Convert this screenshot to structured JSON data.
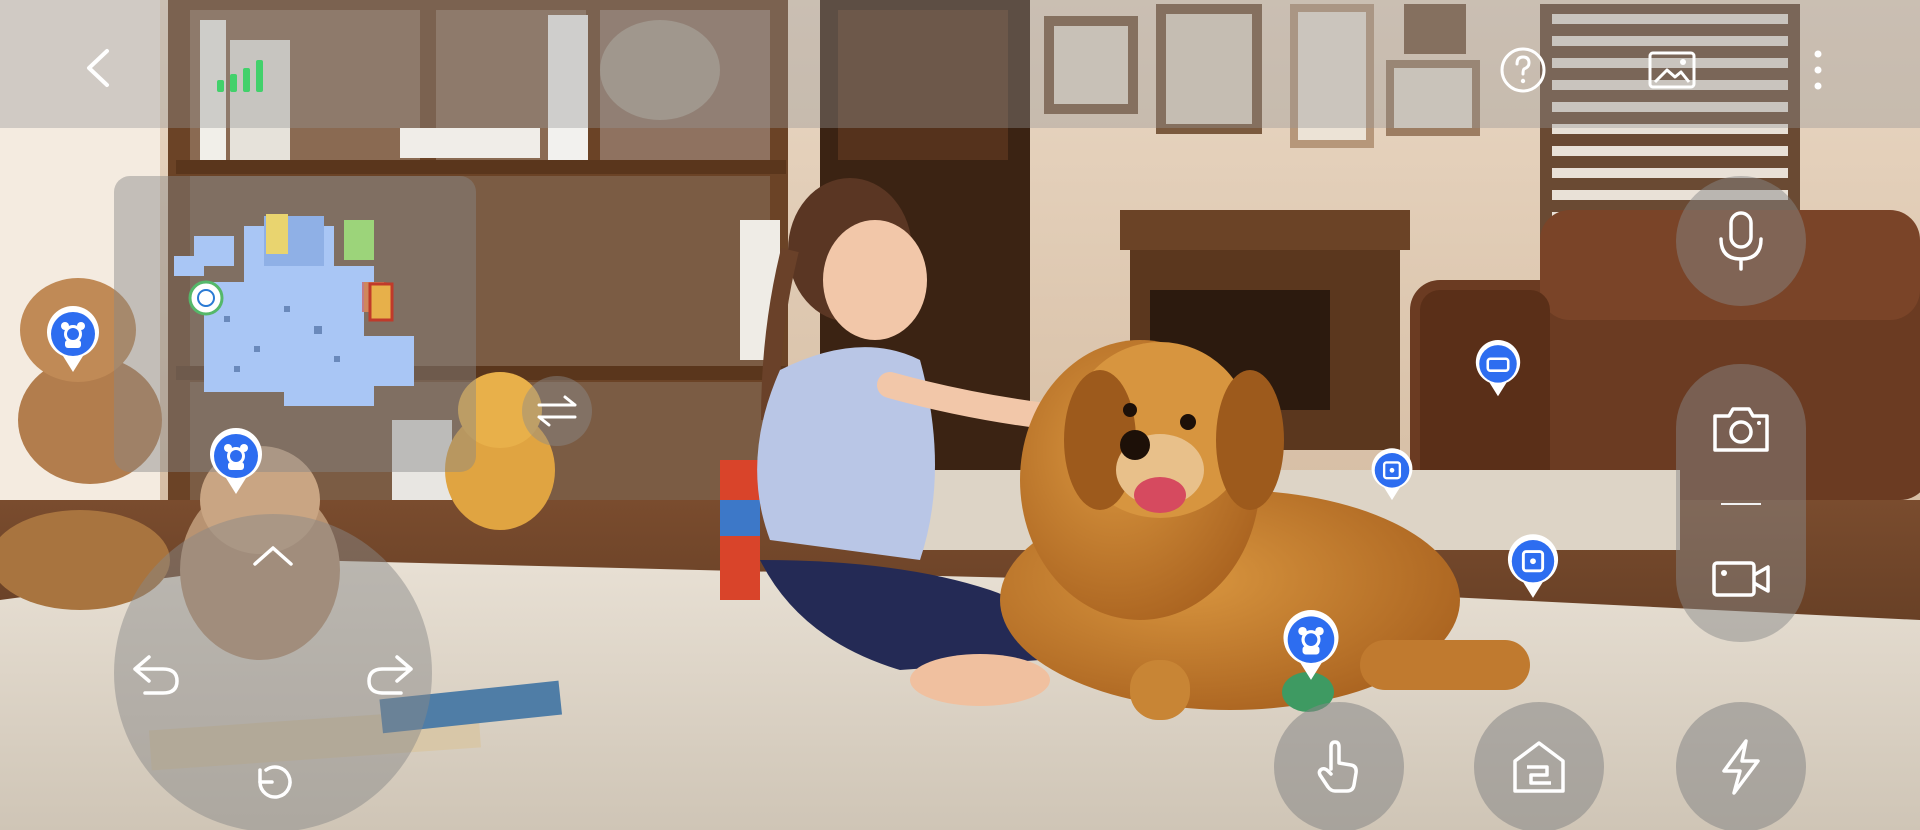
{
  "app": {
    "title": ""
  },
  "topbar": {
    "back_icon": "chevron-left-icon",
    "signal_icon": "signal-strength-icon",
    "help_icon": "question-circle-icon",
    "gallery_icon": "image-gallery-icon",
    "more_icon": "more-vertical-icon"
  },
  "minimap": {
    "icon": "floor-map",
    "swap_icon": "swap-arrows-icon"
  },
  "dpad": {
    "up_icon": "chevron-up-icon",
    "turn_left_icon": "turn-left-icon",
    "turn_right_icon": "turn-right-icon",
    "u_turn_icon": "rotate-back-icon"
  },
  "right_controls": {
    "mic_icon": "microphone-icon",
    "photo_icon": "camera-icon",
    "video_icon": "video-camera-icon"
  },
  "bottom_controls": {
    "tap_icon": "hand-pointer-icon",
    "home_icon": "dock-home-icon",
    "flash_icon": "lightning-icon"
  },
  "pins": [
    {
      "type": "teddy-bear-pin-icon"
    },
    {
      "type": "teddy-bear-pin-icon"
    },
    {
      "type": "sofa-pin-icon"
    },
    {
      "type": "object-pin-icon"
    },
    {
      "type": "object-pin-icon"
    },
    {
      "type": "teddy-bear-pin-icon"
    }
  ],
  "colors": {
    "pin_blue": "#2d6df0",
    "signal_green": "#42d16b",
    "map_blue": "#a9c6f5"
  }
}
